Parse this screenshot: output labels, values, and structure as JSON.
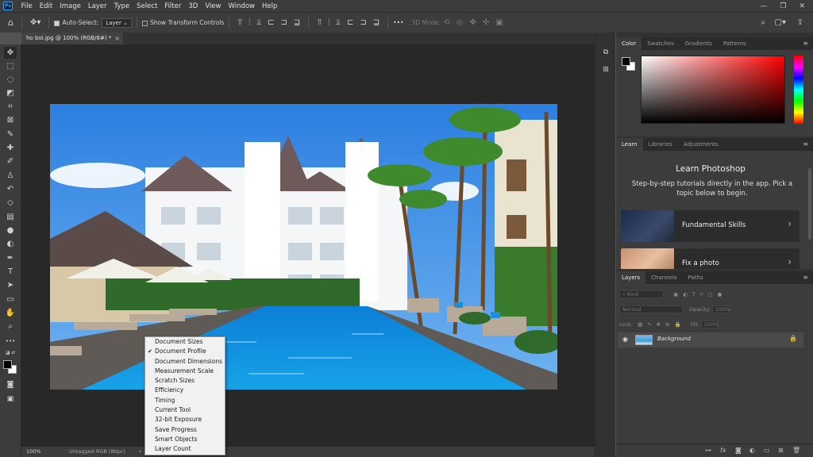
{
  "menubar": {
    "logo": "Ps",
    "items": [
      "File",
      "Edit",
      "Image",
      "Layer",
      "Type",
      "Select",
      "Filter",
      "3D",
      "View",
      "Window",
      "Help"
    ],
    "window_controls": [
      "—",
      "❐",
      "✕"
    ]
  },
  "options_bar": {
    "auto_select_label": "Auto-Select:",
    "auto_select_checked": true,
    "auto_select_target": "Layer",
    "show_transform_label": "Show Transform Controls",
    "show_transform_checked": false,
    "more_label": "•••",
    "mode_label": "3D Mode:"
  },
  "document": {
    "tab_title": "ho boi.jpg @ 100% (RGB/8#) *",
    "close_icon": "×"
  },
  "status_bar": {
    "zoom": "100%",
    "info": "Untagged RGB (8bpc)",
    "arrow": "›"
  },
  "status_menu": {
    "items": [
      {
        "label": "Document Sizes",
        "checked": false
      },
      {
        "label": "Document Profile",
        "checked": true
      },
      {
        "label": "Document Dimensions",
        "checked": false
      },
      {
        "label": "Measurement Scale",
        "checked": false
      },
      {
        "label": "Scratch Sizes",
        "checked": false
      },
      {
        "label": "Efficiency",
        "checked": false
      },
      {
        "label": "Timing",
        "checked": false
      },
      {
        "label": "Current Tool",
        "checked": false
      },
      {
        "label": "32-bit Exposure",
        "checked": false
      },
      {
        "label": "Save Progress",
        "checked": false
      },
      {
        "label": "Smart Objects",
        "checked": false
      },
      {
        "label": "Layer Count",
        "checked": false
      }
    ],
    "check_mark": "✔"
  },
  "color_panel": {
    "tabs": [
      "Color",
      "Swatches",
      "Gradients",
      "Patterns"
    ],
    "active_tab": 0,
    "foreground": "#000000",
    "background": "#ffffff",
    "field_hue": "#ff0000"
  },
  "learn_panel": {
    "tabs": [
      "Learn",
      "Libraries",
      "Adjustments"
    ],
    "active_tab": 0,
    "title": "Learn Photoshop",
    "description": "Step-by-step tutorials directly in the app. Pick a topic below to begin.",
    "cards": [
      {
        "label": "Fundamental Skills"
      },
      {
        "label": "Fix a photo"
      }
    ]
  },
  "layers_panel": {
    "tabs": [
      "Layers",
      "Channels",
      "Paths"
    ],
    "active_tab": 0,
    "filter_placeholder": "Kind",
    "blend_mode": "Normal",
    "opacity_label": "Opacity:",
    "opacity_value": "100%",
    "lock_label": "Lock:",
    "fill_label": "Fill:",
    "fill_value": "100%",
    "layers": [
      {
        "name": "Background",
        "visible": true,
        "locked": true
      }
    ],
    "footer_icons": [
      "link-icon",
      "fx-icon",
      "mask-icon",
      "adjustment-icon",
      "group-icon",
      "new-layer-icon",
      "delete-icon"
    ]
  },
  "tools": [
    {
      "name": "move-tool-icon",
      "glyph": "✥",
      "active": true
    },
    {
      "name": "marquee-tool-icon",
      "glyph": "⬚",
      "active": false
    },
    {
      "name": "lasso-tool-icon",
      "glyph": "◌",
      "active": false
    },
    {
      "name": "object-select-tool-icon",
      "glyph": "◩",
      "active": false
    },
    {
      "name": "crop-tool-icon",
      "glyph": "⌗",
      "active": false
    },
    {
      "name": "frame-tool-icon",
      "glyph": "⊠",
      "active": false
    },
    {
      "name": "eyedropper-tool-icon",
      "glyph": "✎",
      "active": false
    },
    {
      "name": "healing-brush-tool-icon",
      "glyph": "✚",
      "active": false
    },
    {
      "name": "brush-tool-icon",
      "glyph": "✐",
      "active": false
    },
    {
      "name": "clone-stamp-tool-icon",
      "glyph": "♙",
      "active": false
    },
    {
      "name": "history-brush-tool-icon",
      "glyph": "↶",
      "active": false
    },
    {
      "name": "eraser-tool-icon",
      "glyph": "◇",
      "active": false
    },
    {
      "name": "gradient-tool-icon",
      "glyph": "▤",
      "active": false
    },
    {
      "name": "blur-tool-icon",
      "glyph": "●",
      "active": false
    },
    {
      "name": "dodge-tool-icon",
      "glyph": "◐",
      "active": false
    },
    {
      "name": "pen-tool-icon",
      "glyph": "✒",
      "active": false
    },
    {
      "name": "type-tool-icon",
      "glyph": "T",
      "active": false
    },
    {
      "name": "path-select-tool-icon",
      "glyph": "➤",
      "active": false
    },
    {
      "name": "rectangle-tool-icon",
      "glyph": "▭",
      "active": false
    },
    {
      "name": "hand-tool-icon",
      "glyph": "✋",
      "active": false
    },
    {
      "name": "zoom-tool-icon",
      "glyph": "⌕",
      "active": false
    },
    {
      "name": "more-tools-icon",
      "glyph": "•••",
      "active": false
    }
  ]
}
